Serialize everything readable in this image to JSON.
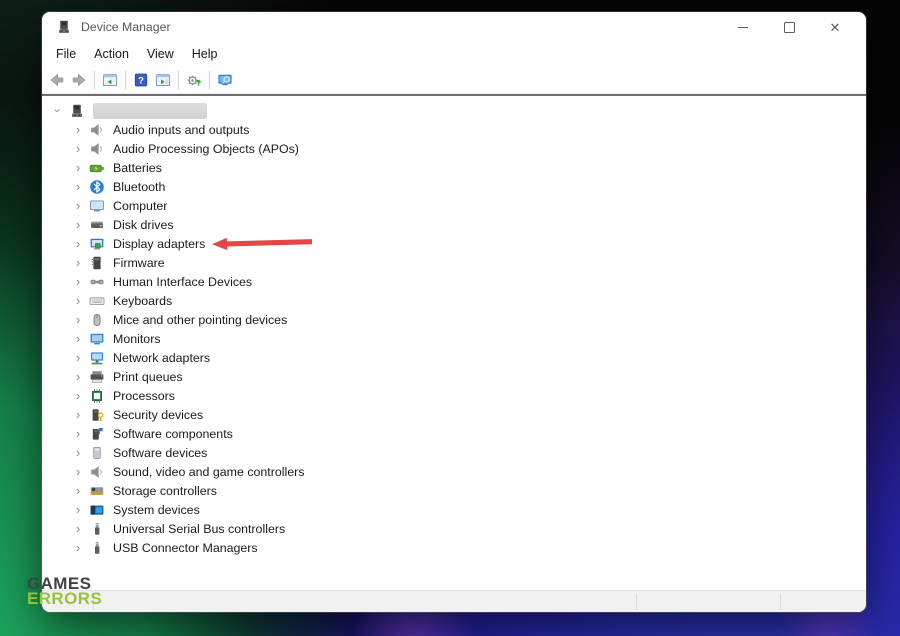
{
  "window": {
    "title": "Device Manager",
    "menu_items": [
      "File",
      "Action",
      "View",
      "Help"
    ],
    "toolbar": [
      {
        "name": "back",
        "separator_after": false
      },
      {
        "name": "forward",
        "separator_after": true
      },
      {
        "name": "show-console-tree",
        "separator_after": true
      },
      {
        "name": "help",
        "separator_after": false
      },
      {
        "name": "properties",
        "separator_after": true
      },
      {
        "name": "scan-hardware-changes",
        "separator_after": true
      },
      {
        "name": "devices-view",
        "separator_after": false
      }
    ],
    "controls": [
      "minimize",
      "maximize",
      "close"
    ]
  },
  "tree": {
    "root": {
      "icon": "computer-root",
      "redacted": true,
      "expanded": true
    },
    "items": [
      {
        "label": "Audio inputs and outputs",
        "icon": "speaker"
      },
      {
        "label": "Audio Processing Objects (APOs)",
        "icon": "speaker"
      },
      {
        "label": "Batteries",
        "icon": "battery"
      },
      {
        "label": "Bluetooth",
        "icon": "bluetooth"
      },
      {
        "label": "Computer",
        "icon": "computer"
      },
      {
        "label": "Disk drives",
        "icon": "disk"
      },
      {
        "label": "Display adapters",
        "icon": "display",
        "annotated": true
      },
      {
        "label": "Firmware",
        "icon": "firmware"
      },
      {
        "label": "Human Interface Devices",
        "icon": "hid"
      },
      {
        "label": "Keyboards",
        "icon": "keyboard"
      },
      {
        "label": "Mice and other pointing devices",
        "icon": "mouse"
      },
      {
        "label": "Monitors",
        "icon": "monitor"
      },
      {
        "label": "Network adapters",
        "icon": "network"
      },
      {
        "label": "Print queues",
        "icon": "printer"
      },
      {
        "label": "Processors",
        "icon": "processor"
      },
      {
        "label": "Security devices",
        "icon": "security"
      },
      {
        "label": "Software components",
        "icon": "software-component"
      },
      {
        "label": "Software devices",
        "icon": "software-device"
      },
      {
        "label": "Sound, video and game controllers",
        "icon": "speaker"
      },
      {
        "label": "Storage controllers",
        "icon": "storage"
      },
      {
        "label": "System devices",
        "icon": "system"
      },
      {
        "label": "Universal Serial Bus controllers",
        "icon": "usb"
      },
      {
        "label": "USB Connector Managers",
        "icon": "usb"
      }
    ]
  },
  "annotation": {
    "type": "arrow",
    "points_to": "Display adapters",
    "color": "#e24646"
  },
  "watermark": {
    "line1": "GAMES",
    "line2": "ERRORS",
    "color1": "#414141",
    "color2": "#97c13e"
  },
  "colors": {
    "window_bg": "#fdfdfd",
    "status_bar": "#f1f1f1",
    "bg_black": "#050505",
    "bg_green": "#1fae60",
    "bg_blue": "#2d39b6",
    "bg_purple": "#6d2fd0"
  }
}
